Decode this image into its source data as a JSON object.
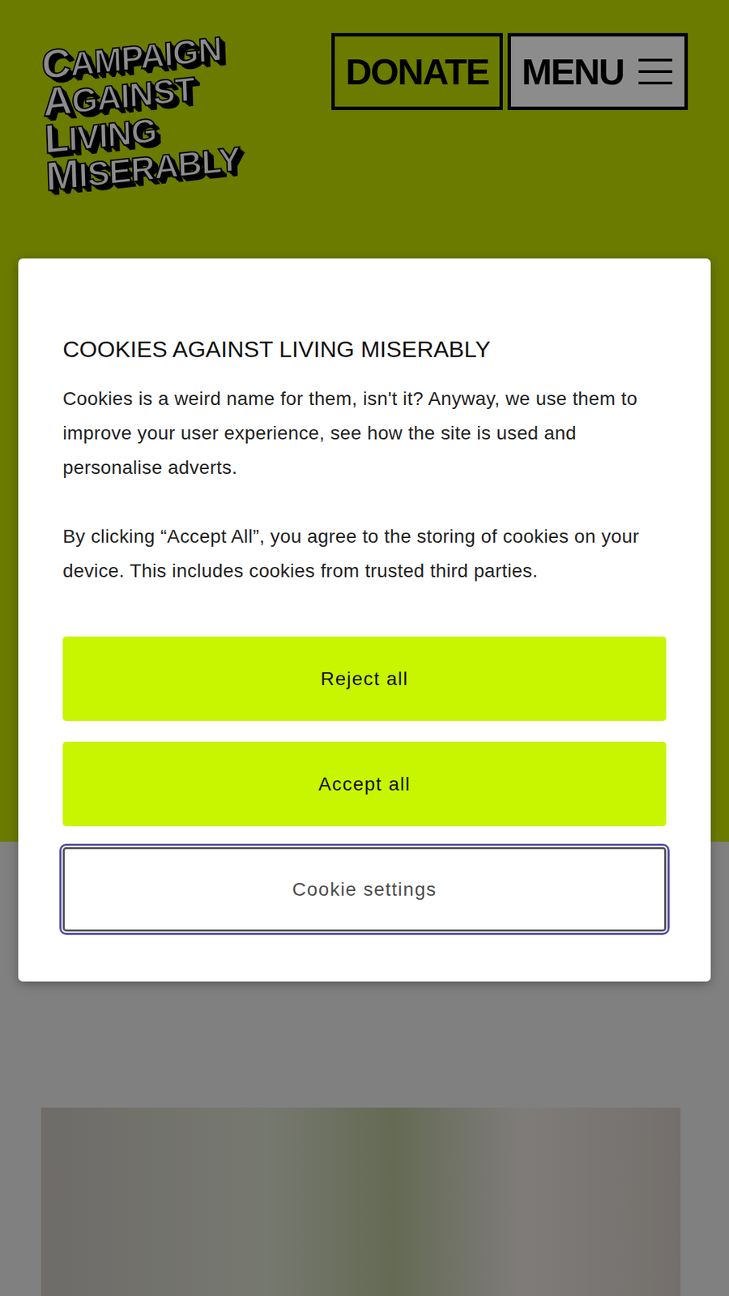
{
  "header": {
    "logo": [
      "CAMPAIGN",
      "AGAINST",
      "LIVING",
      "MISERABLY"
    ],
    "donate": "DONATE",
    "menu": "MENU"
  },
  "cookie_dialog": {
    "title": "COOKIES AGAINST LIVING MISERABLY",
    "paragraphs": [
      "Cookies is a weird name for them, isn't it? Anyway, we use them to improve your user experience, see how the site is used and personalise adverts.",
      "By clicking “Accept All”, you agree to the storing of cookies on your device. This includes cookies from trusted third parties."
    ],
    "buttons": [
      {
        "label": "Reject all",
        "kind": "primary",
        "focused": false
      },
      {
        "label": "Accept all",
        "kind": "primary",
        "focused": false
      },
      {
        "label": "Cookie settings",
        "kind": "secondary",
        "focused": true
      }
    ]
  }
}
